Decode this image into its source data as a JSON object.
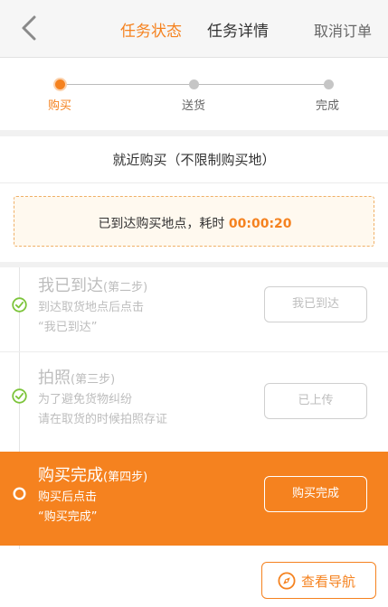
{
  "header": {
    "tab_status": "任务状态",
    "tab_detail": "任务详情",
    "cancel_label": "取消订单"
  },
  "progress": {
    "steps": [
      {
        "label": "购买",
        "active": true
      },
      {
        "label": "送货",
        "active": false
      },
      {
        "label": "完成",
        "active": false
      }
    ]
  },
  "task": {
    "title": "就近购买（不限制购买地）",
    "arrive_prefix": "已到达购买地点，耗时",
    "elapsed": "00:00:20"
  },
  "steps": [
    {
      "title": "我已到达",
      "step": "(第二步)",
      "desc1": "到达取货地点后点击",
      "desc2": "“我已到达”",
      "button": "我已到达",
      "state": "done"
    },
    {
      "title": "拍照",
      "step": "(第三步)",
      "desc1": "为了避免货物纠纷",
      "desc2": "请在取货的时候拍照存证",
      "button": "已上传",
      "state": "done"
    },
    {
      "title": "购买完成",
      "step": "(第四步)",
      "desc1": "购买后点击",
      "desc2": "“购买完成”",
      "button": "购买完成",
      "state": "current"
    }
  ],
  "footer": {
    "nav_label": "查看导航"
  },
  "colors": {
    "accent": "#f5821f",
    "done_check": "#7cc43a"
  },
  "icons": {
    "back": "chevron-left-icon",
    "done": "check-circle-icon",
    "current": "ring-icon",
    "nav": "compass-icon"
  }
}
